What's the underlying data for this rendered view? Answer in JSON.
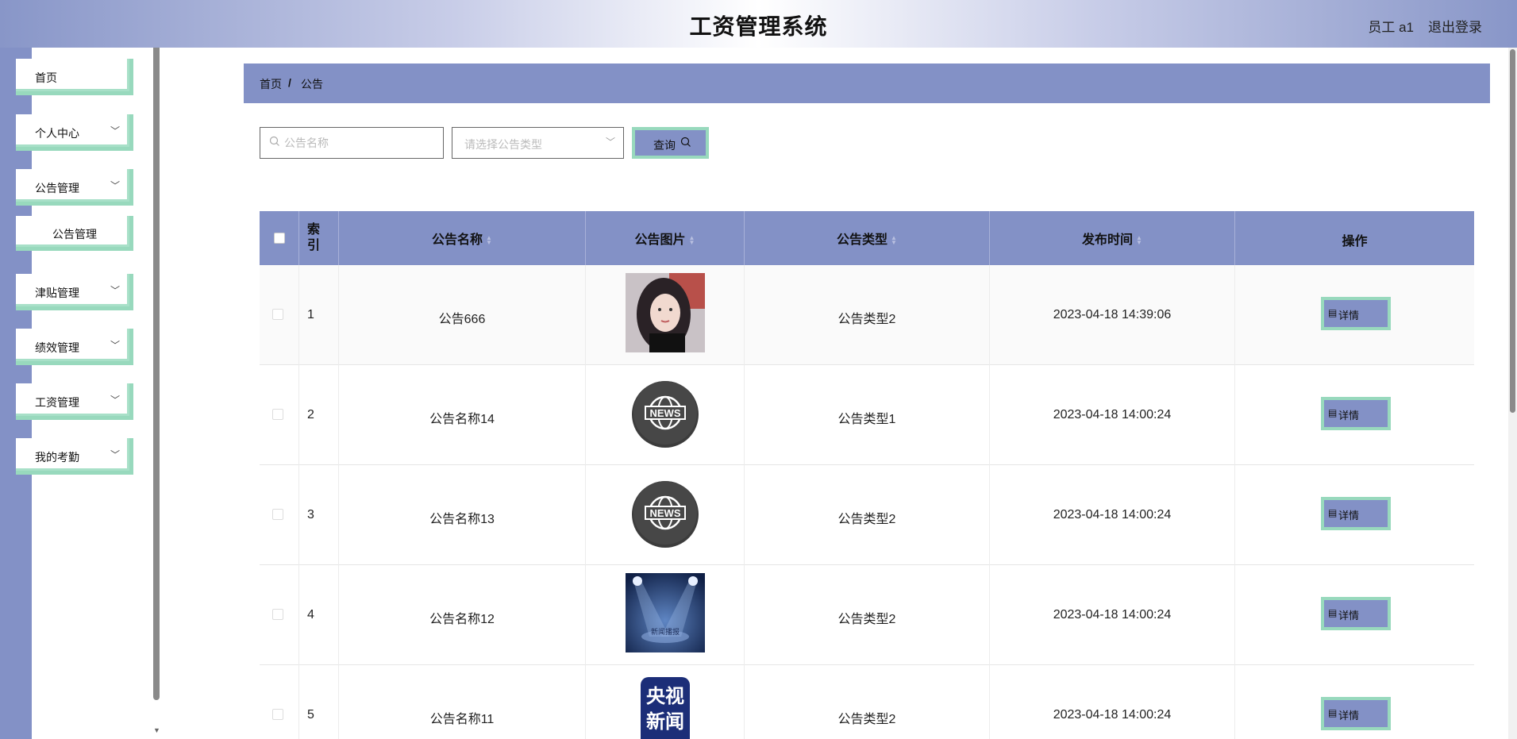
{
  "header": {
    "title": "工资管理系统",
    "user": "员工 a1",
    "logout": "退出登录"
  },
  "sidebar": {
    "items": [
      {
        "label": "首页"
      },
      {
        "label": "个人中心"
      },
      {
        "label": "公告管理"
      },
      {
        "label": "公告管理"
      },
      {
        "label": "津贴管理"
      },
      {
        "label": "绩效管理"
      },
      {
        "label": "工资管理"
      },
      {
        "label": "我的考勤"
      }
    ]
  },
  "breadcrumb": {
    "home": "首页",
    "sep": "/",
    "current": "公告"
  },
  "search": {
    "placeholder": "公告名称",
    "type_placeholder": "请选择公告类型",
    "query_label": "查询"
  },
  "table": {
    "headers": {
      "index": "索引",
      "name": "公告名称",
      "image": "公告图片",
      "type": "公告类型",
      "time": "发布时间",
      "op": "操作"
    },
    "rows": [
      {
        "index": "1",
        "name": "公告666",
        "image": "portrait-photo",
        "type": "公告类型2",
        "time": "2023-04-18 14:39:06",
        "op": "详情"
      },
      {
        "index": "2",
        "name": "公告名称14",
        "image": "news-globe-icon",
        "type": "公告类型1",
        "time": "2023-04-18 14:00:24",
        "op": "详情"
      },
      {
        "index": "3",
        "name": "公告名称13",
        "image": "news-globe-icon",
        "type": "公告类型2",
        "time": "2023-04-18 14:00:24",
        "op": "详情"
      },
      {
        "index": "4",
        "name": "公告名称12",
        "image": "stage-spotlight-photo",
        "type": "公告类型2",
        "time": "2023-04-18 14:00:24",
        "op": "详情"
      },
      {
        "index": "5",
        "name": "公告名称11",
        "image": "cctv-news-logo",
        "type": "公告类型2",
        "time": "2023-04-18 14:00:24",
        "op": "详情"
      }
    ],
    "stage_caption": "新闻播报",
    "cctv_logo": [
      "央视",
      "新闻"
    ],
    "news_text": "NEWS"
  },
  "colors": {
    "accent": "#8391c6",
    "border_accent": "#98d9bd"
  }
}
